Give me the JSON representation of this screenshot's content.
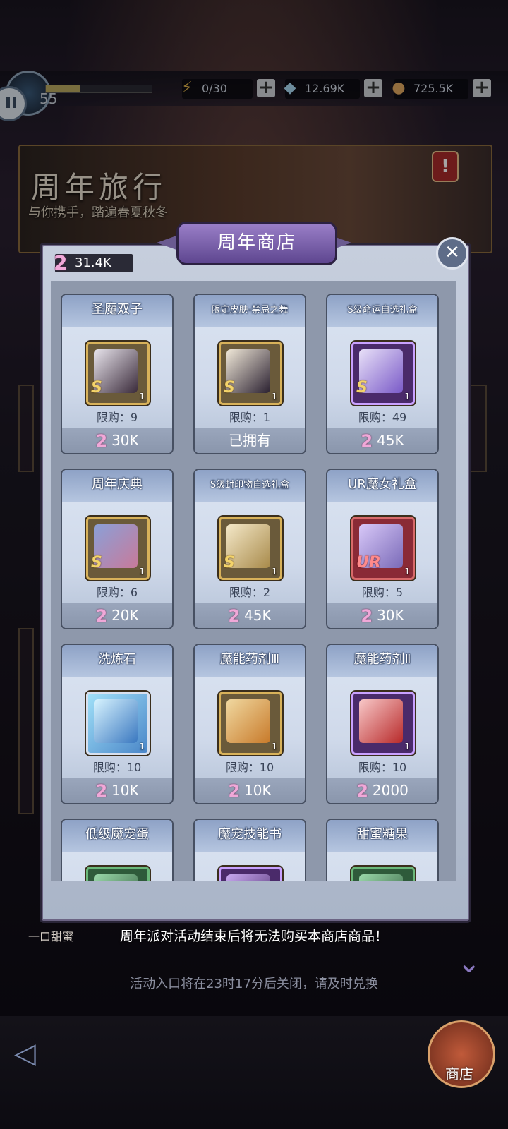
{
  "hud": {
    "level": "55",
    "xp_fraction": 0.32,
    "energy": "0/30",
    "diamonds": "12.69K",
    "coins": "725.5K",
    "plus_label": "+"
  },
  "banner": {
    "title": "周年旅行",
    "subtitle": "与你携手，踏遍春夏秋冬"
  },
  "modal": {
    "title": "周年商店",
    "close_label": "✕",
    "token_symbol": "2",
    "currency_amount": "31.4K"
  },
  "items": [
    {
      "name": "圣魔双子",
      "rank": "S",
      "qty": "1",
      "limit": "限购：9",
      "price": "30K",
      "owned": false,
      "icon": "character-portrait-icon"
    },
    {
      "name": "限定皮肤-禁忌之舞",
      "rank": "S",
      "qty": "1",
      "limit": "限购：1",
      "price": "已拥有",
      "owned": true,
      "icon": "skin-portrait-icon"
    },
    {
      "name": "S级命运自选礼盒",
      "rank": "S",
      "qty": "1",
      "limit": "限购：49",
      "price": "45K",
      "owned": false,
      "icon": "chest-icon"
    },
    {
      "name": "周年庆典",
      "rank": "S",
      "qty": "1",
      "limit": "限购：6",
      "price": "20K",
      "owned": false,
      "icon": "card-pack-icon"
    },
    {
      "name": "S级封印物自选礼盒",
      "rank": "S",
      "qty": "1",
      "limit": "限购：2",
      "price": "45K",
      "owned": false,
      "icon": "gold-chest-icon"
    },
    {
      "name": "UR魔女礼盒",
      "rank": "UR",
      "qty": "1",
      "limit": "限购：5",
      "price": "30K",
      "owned": false,
      "icon": "gift-box-icon"
    },
    {
      "name": "洗炼石",
      "rank": "",
      "qty": "1",
      "limit": "限购：10",
      "price": "10K",
      "owned": false,
      "icon": "refine-stone-icon"
    },
    {
      "name": "魔能药剂Ⅲ",
      "rank": "",
      "qty": "1",
      "limit": "限购：10",
      "price": "10K",
      "owned": false,
      "icon": "potion-icon"
    },
    {
      "name": "魔能药剂Ⅱ",
      "rank": "",
      "qty": "1",
      "limit": "限购：10",
      "price": "2000",
      "owned": false,
      "icon": "red-potion-icon"
    },
    {
      "name": "低级魔宠蛋",
      "rank": "",
      "qty": "",
      "limit": "",
      "price": "",
      "owned": false,
      "icon": "pet-egg-icon"
    },
    {
      "name": "魔宠技能书",
      "rank": "",
      "qty": "",
      "limit": "",
      "price": "",
      "owned": false,
      "icon": "skill-book-icon"
    },
    {
      "name": "甜蜜糖果",
      "rank": "",
      "qty": "",
      "limit": "",
      "price": "",
      "owned": false,
      "icon": "candy-icon"
    }
  ],
  "footer": {
    "left_text": "一口甜蜜",
    "notice": "周年派对活动结束后将无法购买本商店商品！",
    "close_notice": "活动入口将在23时17分后关闭，请及时兑换",
    "shop_label": "商店"
  }
}
